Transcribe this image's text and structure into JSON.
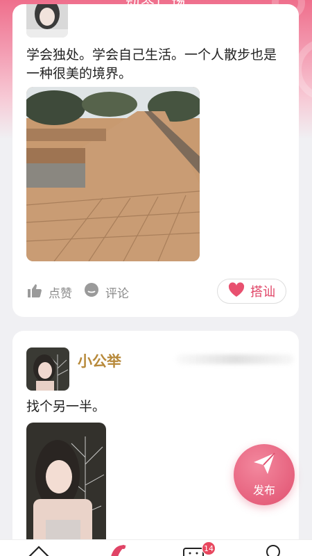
{
  "header": {
    "title": "动态广场"
  },
  "posts": [
    {
      "text": "学会独处。学会自己生活。一个人散步也是一种很美的境界。",
      "actions": {
        "like": "点赞",
        "comment": "评论",
        "chat": "搭讪"
      }
    },
    {
      "username": "小公举",
      "text": "找个另一半。"
    }
  ],
  "fab": {
    "label": "发布"
  },
  "tabbar": {
    "badge_count": "14"
  },
  "colors": {
    "accent": "#e04466",
    "username": "#b7893a",
    "fab": "#e0506f"
  },
  "icons": [
    "like-icon",
    "comment-icon",
    "heart-icon",
    "send-icon",
    "home-icon",
    "square-icon",
    "message-icon",
    "profile-icon"
  ]
}
